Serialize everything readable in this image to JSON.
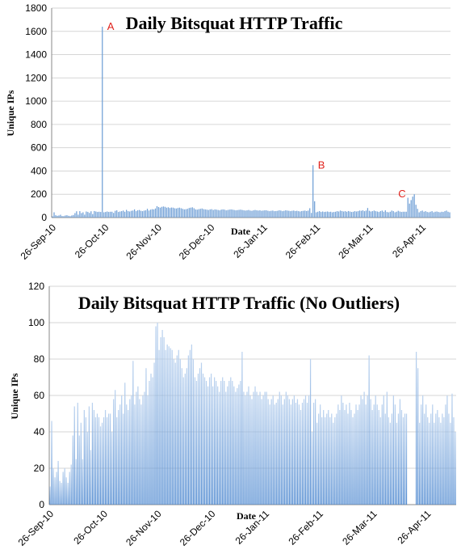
{
  "chart_data": [
    {
      "type": "bar",
      "title": "Daily Bitsquat HTTP Traffic",
      "xlabel": "Date",
      "ylabel": "Unique IPs",
      "ylim": [
        0,
        1800
      ],
      "yticks": [
        "0",
        "200",
        "400",
        "600",
        "800",
        "1000",
        "1200",
        "1400",
        "1600",
        "1800"
      ],
      "xticks": [
        "26-Sep-10",
        "26-Oct-10",
        "26-Nov-10",
        "26-Dec-10",
        "26-Jan-11",
        "26-Feb-11",
        "26-Mar-11",
        "26-Apr-11"
      ],
      "grid": true,
      "annotations": [
        {
          "text": "A",
          "x": 31,
          "y": 1640
        },
        {
          "text": "B",
          "x": 162,
          "y": 450
        },
        {
          "text": "C",
          "x": 212,
          "y": 200
        }
      ],
      "x": [
        0,
        1,
        2,
        3,
        4,
        5,
        6,
        7,
        8,
        9,
        10,
        11,
        12,
        13,
        14,
        15,
        16,
        17,
        18,
        19,
        20,
        21,
        22,
        23,
        24,
        25,
        26,
        27,
        28,
        29,
        30,
        31,
        32,
        33,
        34,
        35,
        36,
        37,
        38,
        39,
        40,
        41,
        42,
        43,
        44,
        45,
        46,
        47,
        48,
        49,
        50,
        51,
        52,
        53,
        54,
        55,
        56,
        57,
        58,
        59,
        60,
        61,
        62,
        63,
        64,
        65,
        66,
        67,
        68,
        69,
        70,
        71,
        72,
        73,
        74,
        75,
        76,
        77,
        78,
        79,
        80,
        81,
        82,
        83,
        84,
        85,
        86,
        87,
        88,
        89,
        90,
        91,
        92,
        93,
        94,
        95,
        96,
        97,
        98,
        99,
        100,
        101,
        102,
        103,
        104,
        105,
        106,
        107,
        108,
        109,
        110,
        111,
        112,
        113,
        114,
        115,
        116,
        117,
        118,
        119,
        120,
        121,
        122,
        123,
        124,
        125,
        126,
        127,
        128,
        129,
        130,
        131,
        132,
        133,
        134,
        135,
        136,
        137,
        138,
        139,
        140,
        141,
        142,
        143,
        144,
        145,
        146,
        147,
        148,
        149,
        150,
        151,
        152,
        153,
        154,
        155,
        156,
        157,
        158,
        159,
        160,
        161,
        162,
        163,
        164,
        165,
        166,
        167,
        168,
        169,
        170,
        171,
        172,
        173,
        174,
        175,
        176,
        177,
        178,
        179,
        180,
        181,
        182,
        183,
        184,
        185,
        186,
        187,
        188,
        189,
        190,
        191,
        192,
        193,
        194,
        195,
        196,
        197,
        198,
        199,
        200,
        201,
        202,
        203,
        204,
        205,
        206,
        207,
        208,
        209,
        210,
        211,
        212,
        213,
        214,
        215,
        216,
        217,
        218,
        219,
        220,
        221,
        222,
        223,
        224,
        225,
        226,
        227,
        228,
        229,
        230,
        231,
        232,
        233,
        234,
        235,
        236,
        237,
        238,
        239,
        240,
        241,
        242,
        243
      ],
      "values": [
        10,
        45,
        20,
        15,
        18,
        24,
        13,
        12,
        18,
        20,
        15,
        12,
        18,
        22,
        38,
        54,
        25,
        55,
        38,
        45,
        25,
        52,
        48,
        40,
        54,
        30,
        56,
        52,
        48,
        50,
        48,
        1640,
        45,
        48,
        52,
        48,
        50,
        50,
        40,
        58,
        62,
        48,
        52,
        55,
        60,
        50,
        66,
        55,
        52,
        58,
        60,
        70,
        55,
        62,
        65,
        58,
        55,
        60,
        62,
        75,
        60,
        68,
        72,
        70,
        78,
        98,
        90,
        85,
        92,
        95,
        92,
        85,
        88,
        82,
        86,
        85,
        80,
        78,
        82,
        85,
        80,
        75,
        70,
        72,
        75,
        82,
        85,
        88,
        80,
        70,
        68,
        72,
        75,
        78,
        72,
        70,
        68,
        65,
        70,
        72,
        65,
        70,
        68,
        65,
        62,
        68,
        70,
        68,
        62,
        65,
        68,
        70,
        68,
        65,
        62,
        64,
        66,
        68,
        65,
        62,
        60,
        62,
        65,
        60,
        58,
        62,
        65,
        62,
        60,
        62,
        58,
        60,
        62,
        62,
        58,
        55,
        58,
        60,
        55,
        56,
        58,
        62,
        60,
        55,
        58,
        62,
        60,
        58,
        55,
        58,
        60,
        56,
        58,
        55,
        52,
        56,
        58,
        60,
        56,
        60,
        80,
        40,
        450,
        140,
        45,
        50,
        55,
        48,
        52,
        48,
        50,
        52,
        48,
        50,
        45,
        48,
        50,
        55,
        52,
        60,
        56,
        52,
        55,
        50,
        56,
        52,
        48,
        50,
        55,
        52,
        55,
        60,
        58,
        62,
        55,
        60,
        82,
        58,
        52,
        55,
        60,
        55,
        52,
        48,
        55,
        60,
        50,
        62,
        48,
        45,
        50,
        60,
        55,
        45,
        50,
        58,
        52,
        48,
        50,
        50,
        50,
        170,
        120,
        150,
        180,
        200,
        110,
        75,
        45,
        55,
        60,
        50,
        55,
        48,
        45,
        50,
        55,
        45,
        50,
        52,
        48,
        45,
        50,
        48,
        55,
        60,
        50,
        45
      ]
    },
    {
      "type": "bar",
      "title": "Daily Bitsquat HTTP Traffic (No Outliers)",
      "xlabel": "Date",
      "ylabel": "Unique IPs",
      "ylim": [
        0,
        120
      ],
      "yticks": [
        "0",
        "20",
        "40",
        "60",
        "80",
        "100",
        "120"
      ],
      "xticks": [
        "26-Sep-10",
        "26-Oct-10",
        "26-Nov-10",
        "26-Dec-10",
        "26-Jan-11",
        "26-Feb-11",
        "26-Mar-11",
        "26-Apr-11"
      ],
      "grid": true,
      "x": [
        0,
        1,
        2,
        3,
        4,
        5,
        6,
        7,
        8,
        9,
        10,
        11,
        12,
        13,
        14,
        15,
        16,
        17,
        18,
        19,
        20,
        21,
        22,
        23,
        24,
        25,
        26,
        27,
        28,
        29,
        30,
        31,
        32,
        33,
        34,
        35,
        36,
        37,
        38,
        39,
        40,
        41,
        42,
        43,
        44,
        45,
        46,
        47,
        48,
        49,
        50,
        51,
        52,
        53,
        54,
        55,
        56,
        57,
        58,
        59,
        60,
        61,
        62,
        63,
        64,
        65,
        66,
        67,
        68,
        69,
        70,
        71,
        72,
        73,
        74,
        75,
        76,
        77,
        78,
        79,
        80,
        81,
        82,
        83,
        84,
        85,
        86,
        87,
        88,
        89,
        90,
        91,
        92,
        93,
        94,
        95,
        96,
        97,
        98,
        99,
        100,
        101,
        102,
        103,
        104,
        105,
        106,
        107,
        108,
        109,
        110,
        111,
        112,
        113,
        114,
        115,
        116,
        117,
        118,
        119,
        120,
        121,
        122,
        123,
        124,
        125,
        126,
        127,
        128,
        129,
        130,
        131,
        132,
        133,
        134,
        135,
        136,
        137,
        138,
        139,
        140,
        141,
        142,
        143,
        144,
        145,
        146,
        147,
        148,
        149,
        150,
        151,
        152,
        153,
        154,
        155,
        156,
        157,
        158,
        159,
        160,
        161,
        162,
        163,
        164,
        165,
        166,
        167,
        168,
        169,
        170,
        171,
        172,
        173,
        174,
        175,
        176,
        177,
        178,
        179,
        180,
        181,
        182,
        183,
        184,
        185,
        186,
        187,
        188,
        189,
        190,
        191,
        192,
        193,
        194,
        195,
        196,
        197,
        198,
        199,
        200,
        201,
        202,
        203,
        204,
        205,
        206,
        207,
        208,
        209,
        210,
        211,
        212,
        213,
        214,
        215,
        216,
        217,
        218,
        219,
        220,
        221,
        222,
        223,
        224,
        225,
        226,
        227,
        228,
        229,
        230,
        231,
        232,
        233,
        234,
        235,
        236,
        237,
        238,
        239,
        240,
        241,
        242,
        243
      ],
      "values": [
        10,
        46,
        20,
        15,
        18,
        24,
        13,
        12,
        18,
        20,
        15,
        12,
        18,
        22,
        38,
        54,
        25,
        56,
        38,
        45,
        25,
        52,
        48,
        40,
        54,
        30,
        56,
        52,
        48,
        50,
        48,
        43,
        45,
        48,
        52,
        48,
        50,
        50,
        40,
        58,
        63,
        48,
        52,
        55,
        60,
        50,
        67,
        55,
        52,
        58,
        60,
        79,
        55,
        62,
        65,
        58,
        55,
        60,
        62,
        75,
        60,
        68,
        72,
        70,
        78,
        98,
        100,
        85,
        92,
        96,
        92,
        85,
        88,
        87,
        86,
        85,
        80,
        78,
        82,
        85,
        80,
        75,
        70,
        72,
        75,
        82,
        85,
        88,
        80,
        70,
        68,
        72,
        75,
        78,
        72,
        70,
        68,
        65,
        70,
        72,
        65,
        70,
        68,
        65,
        62,
        68,
        70,
        68,
        62,
        65,
        68,
        70,
        68,
        65,
        62,
        64,
        66,
        68,
        84,
        62,
        60,
        62,
        65,
        60,
        58,
        62,
        65,
        62,
        60,
        62,
        58,
        60,
        62,
        62,
        58,
        55,
        58,
        60,
        55,
        56,
        58,
        62,
        60,
        55,
        58,
        62,
        60,
        58,
        55,
        58,
        60,
        56,
        58,
        55,
        52,
        56,
        58,
        60,
        56,
        60,
        80,
        40,
        56,
        58,
        45,
        50,
        55,
        48,
        52,
        48,
        50,
        52,
        48,
        50,
        45,
        48,
        50,
        55,
        52,
        60,
        56,
        52,
        55,
        50,
        56,
        52,
        48,
        50,
        55,
        52,
        55,
        60,
        58,
        62,
        55,
        60,
        82,
        58,
        52,
        55,
        60,
        55,
        52,
        48,
        55,
        60,
        50,
        62,
        48,
        45,
        50,
        60,
        55,
        45,
        50,
        58,
        52,
        48,
        50,
        50,
        0,
        0,
        0,
        0,
        0,
        84,
        75,
        45,
        55,
        60,
        50,
        55,
        48,
        45,
        50,
        55,
        45,
        50,
        52,
        48,
        45,
        50,
        48,
        55,
        60,
        50,
        45,
        61,
        48,
        40
      ]
    }
  ]
}
